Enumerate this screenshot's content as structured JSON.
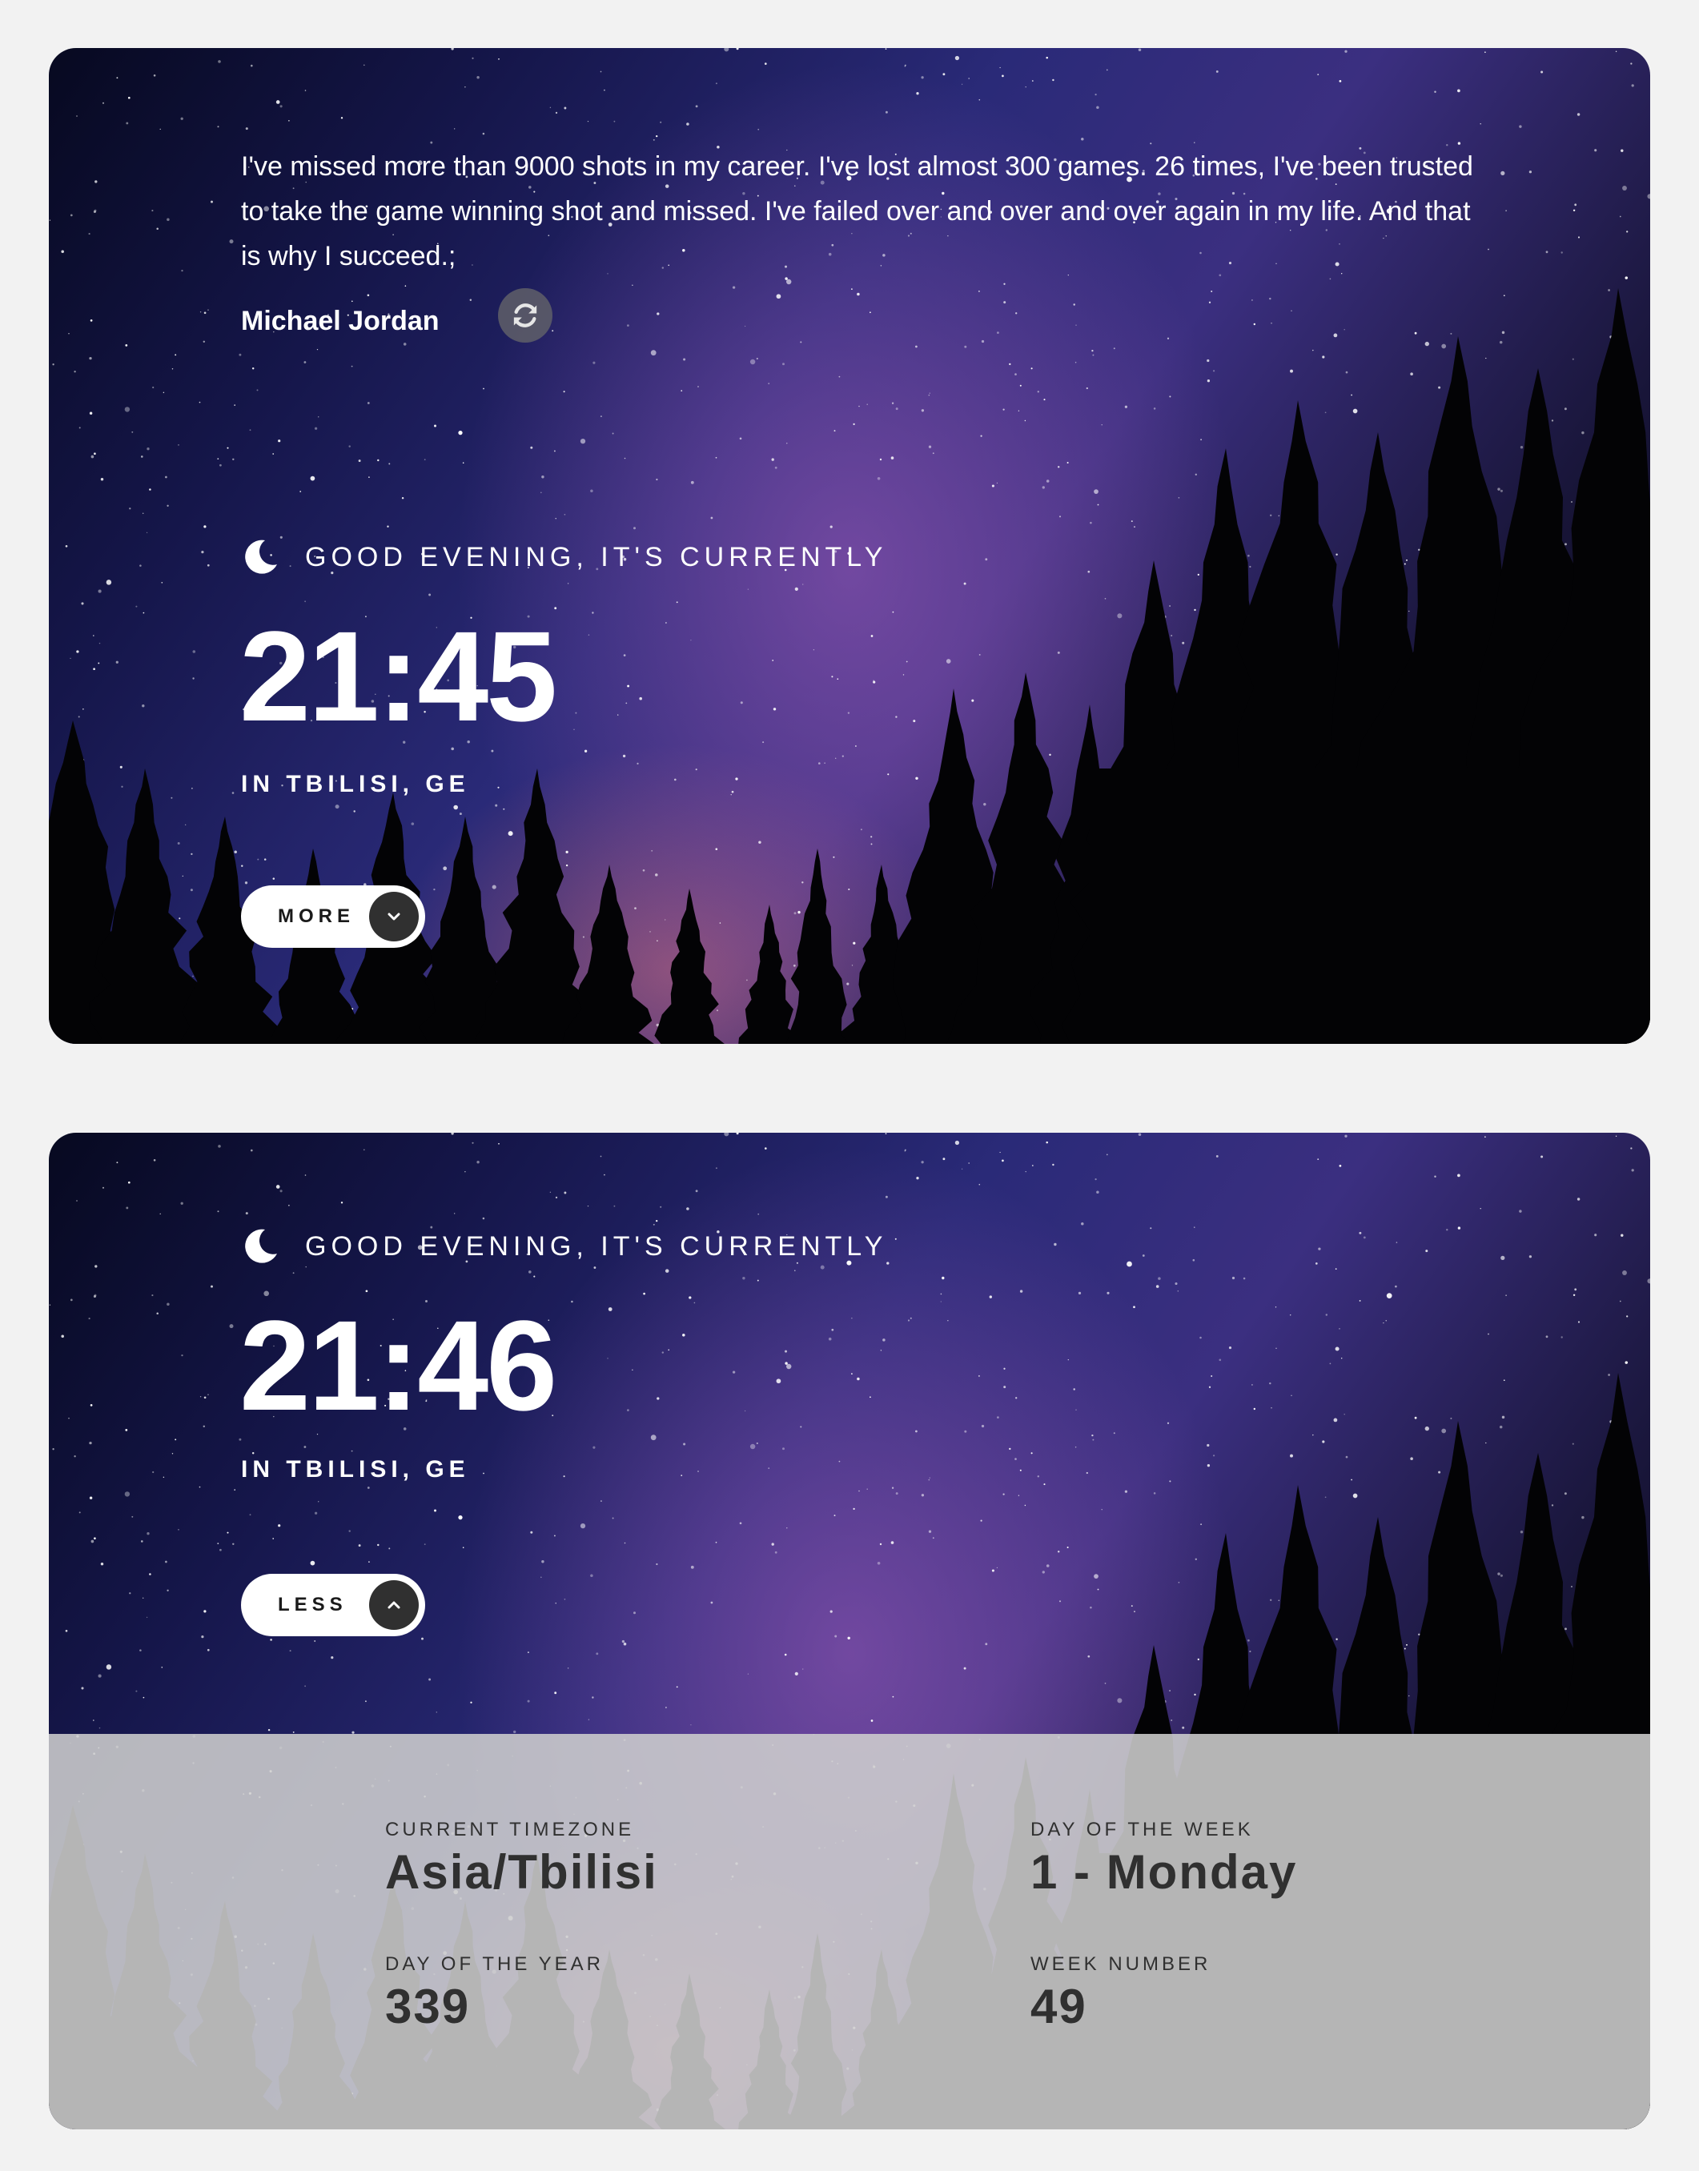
{
  "quote": {
    "text": "I've missed more than 9000 shots in my career. I've lost almost 300 games. 26 times, I've been trusted to take the game winning shot and missed. I've failed over and over and over again in my life. And that is why I succeed.;",
    "author": "Michael Jordan"
  },
  "icons": {
    "refresh": "refresh-icon",
    "moon": "moon-icon",
    "chevron_down": "chevron-down-icon",
    "chevron_up": "chevron-up-icon"
  },
  "collapsed_view": {
    "greeting": "GOOD EVENING, IT'S CURRENTLY",
    "time": "21:45",
    "location": "IN TBILISI, GE",
    "toggle_label": "MORE"
  },
  "expanded_view": {
    "greeting": "GOOD EVENING, IT'S CURRENTLY",
    "time": "21:46",
    "location": "IN TBILISI, GE",
    "toggle_label": "LESS",
    "details": {
      "timezone_label": "CURRENT TIMEZONE",
      "timezone_value": "Asia/Tbilisi",
      "day_of_week_label": "DAY OF THE WEEK",
      "day_of_week_value": "1 - Monday",
      "day_of_year_label": "DAY OF THE YEAR",
      "day_of_year_value": "339",
      "week_number_label": "WEEK NUMBER",
      "week_number_value": "49"
    }
  },
  "colors": {
    "page_background": "#f2f2f2",
    "button_background": "#ffffff",
    "button_circle": "#303030",
    "details_panel": "#cecece",
    "details_text": "#303030"
  }
}
